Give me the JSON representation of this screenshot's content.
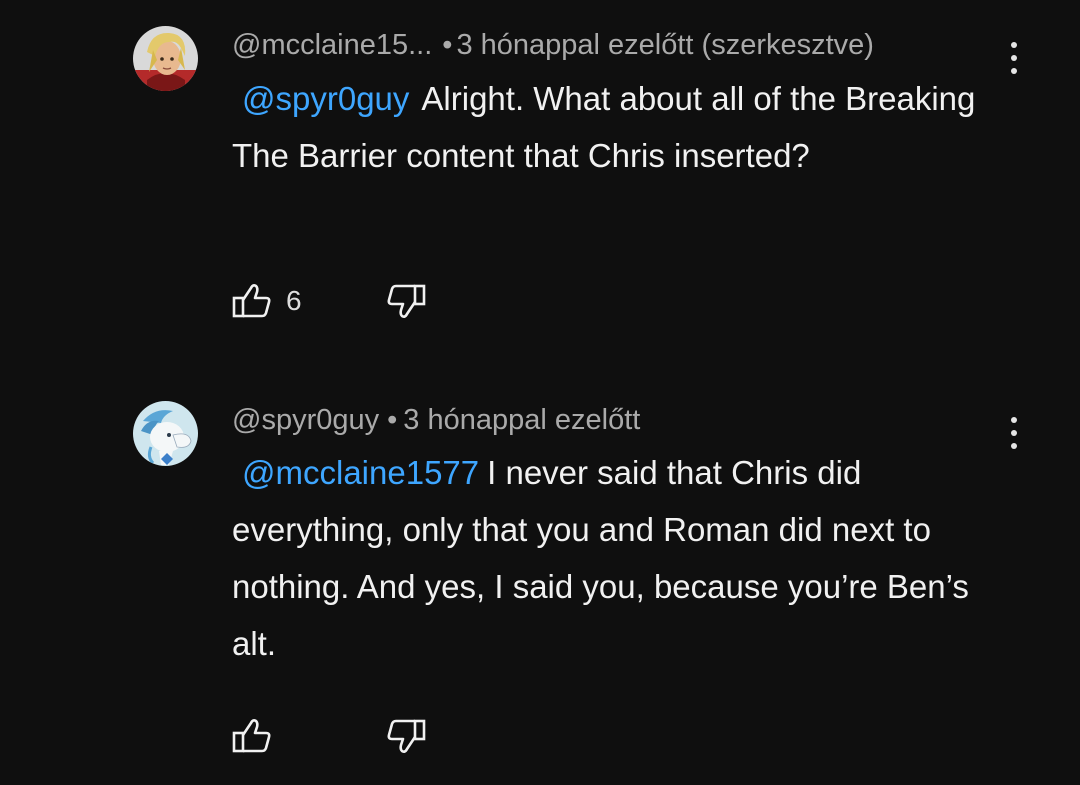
{
  "comments": [
    {
      "author": "@mcclaine15...",
      "separator": "•",
      "time": "3 hónappal ezelőtt (szerkesztve)",
      "mention": "@spyr0guy",
      "text": "Alright. What about all of the Breaking The Barrier content that Chris inserted?",
      "like_count": "6",
      "avatar_icon": "anime-character-avatar"
    },
    {
      "author": "@spyr0guy",
      "separator": "•",
      "time": "3 hónappal ezelőtt",
      "mention": "@mcclaine1577",
      "text": "I never said that Chris did everything, only that you and Roman did next to nothing. And yes, I said you, because you’re Ben’s alt.",
      "like_count": "",
      "avatar_icon": "cartoon-pony-avatar"
    }
  ],
  "icons": {
    "like": "thumbs-up-icon",
    "dislike": "thumbs-down-icon",
    "menu": "more-vert-icon"
  },
  "colors": {
    "background": "#0f0f0f",
    "mention": "#3ea6ff",
    "meta": "#aaaaaa",
    "text": "#f1f1f1"
  }
}
